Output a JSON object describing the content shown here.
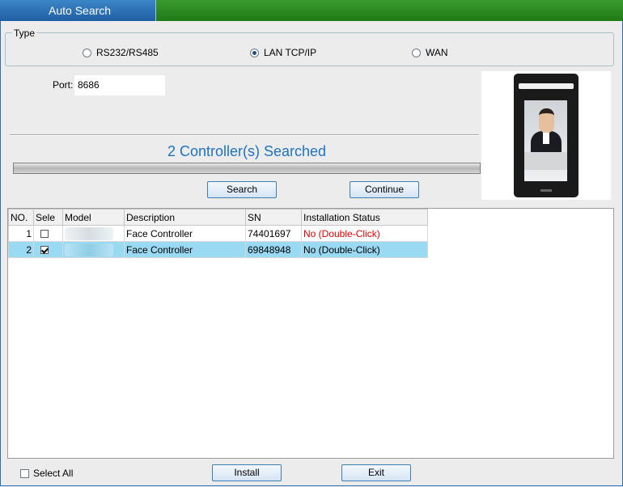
{
  "window": {
    "tab_title": "Auto Search"
  },
  "type_group": {
    "legend": "Type",
    "options": [
      {
        "label": "RS232/RS485",
        "selected": false
      },
      {
        "label": "LAN TCP/IP",
        "selected": true
      },
      {
        "label": "WAN",
        "selected": false
      }
    ]
  },
  "port": {
    "label": "Port:",
    "value": "8686"
  },
  "status": {
    "searched_text": "2 Controller(s) Searched",
    "progress": 1.0
  },
  "buttons": {
    "search": "Search",
    "continue": "Continue",
    "install": "Install",
    "exit": "Exit"
  },
  "table": {
    "headers": [
      "NO.",
      "Sele",
      "Model",
      "Description",
      "SN",
      "Installation Status"
    ],
    "rows": [
      {
        "no": "1",
        "selected": false,
        "model": "",
        "description": "Face Controller",
        "sn": "74401697",
        "status": "No (Double-Click)",
        "status_color": "#e00000"
      },
      {
        "no": "2",
        "selected": true,
        "model": "",
        "description": "Face Controller",
        "sn": "69848948",
        "status": "No (Double-Click)",
        "status_color": "#000000"
      }
    ]
  },
  "footer": {
    "select_all_label": "Select All"
  },
  "colors": {
    "accent_blue": "#1e72c2",
    "selected_row": "#99d9f2",
    "header_green": "#2a8a20"
  }
}
